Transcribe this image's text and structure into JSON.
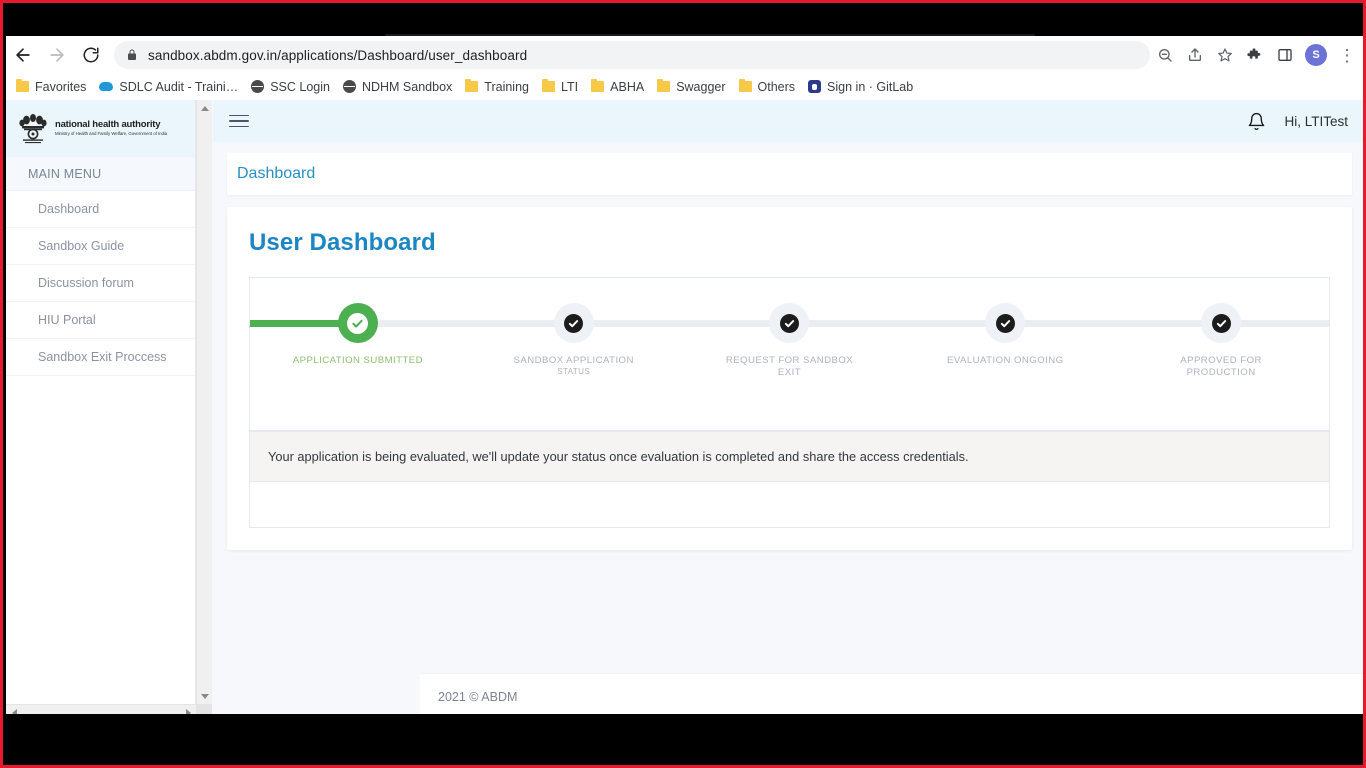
{
  "browser": {
    "back_label": "Back",
    "forward_label": "Forward",
    "reload_label": "Reload",
    "url": "sandbox.abdm.gov.in/applications/Dashboard/user_dashboard",
    "lock_icon": "lock-icon",
    "zoom_icon": "zoom-out-icon",
    "share_icon": "share-icon",
    "bookmark_icon": "star-icon",
    "extensions_icon": "puzzle-piece-icon",
    "sidepanel_icon": "side-panel-icon",
    "avatar_initial": "S",
    "menu_icon": "kebab-menu-icon",
    "bookmarks": [
      {
        "label": "Favorites",
        "icon": "folder-icon"
      },
      {
        "label": "SDLC Audit - Traini…",
        "icon": "cloud-icon"
      },
      {
        "label": "SSC Login",
        "icon": "globe-icon"
      },
      {
        "label": "NDHM Sandbox",
        "icon": "globe-icon"
      },
      {
        "label": "Training",
        "icon": "folder-icon"
      },
      {
        "label": "LTI",
        "icon": "folder-icon"
      },
      {
        "label": "ABHA",
        "icon": "folder-icon"
      },
      {
        "label": "Swagger",
        "icon": "folder-icon"
      },
      {
        "label": "Others",
        "icon": "folder-icon"
      },
      {
        "label": "Sign in · GitLab",
        "icon": "gitlab-icon"
      }
    ]
  },
  "sidebar": {
    "logo": {
      "line1": "national health authority",
      "line2": "Ministry of Health and Family Welfare, Government of India"
    },
    "section_title": "MAIN MENU",
    "items": [
      {
        "label": "Dashboard"
      },
      {
        "label": "Sandbox Guide"
      },
      {
        "label": "Discussion forum"
      },
      {
        "label": "HIU Portal"
      },
      {
        "label": "Sandbox Exit Proccess"
      }
    ]
  },
  "topbar": {
    "menu_toggle_icon": "hamburger-icon",
    "notification_icon": "bell-icon",
    "greeting": "Hi, LTITest"
  },
  "breadcrumb": {
    "title": "Dashboard"
  },
  "panel": {
    "title": "User Dashboard",
    "status_message": "Your application is being evaluated, we'll update your status once evaluation is completed and share the access credentials."
  },
  "stepper": {
    "steps": [
      {
        "label": "APPLICATION SUBMITTED",
        "sub": "",
        "state": "done"
      },
      {
        "label": "SANDBOX APPLICATION",
        "sub": "STATUS",
        "state": "pending"
      },
      {
        "label": "REQUEST FOR SANDBOX EXIT",
        "sub": "",
        "state": "pending"
      },
      {
        "label": "EVALUATION ONGOING",
        "sub": "",
        "state": "pending"
      },
      {
        "label": "APPROVED FOR PRODUCTION",
        "sub": "",
        "state": "pending"
      }
    ]
  },
  "footer": {
    "copyright": "2021 © ABDM"
  },
  "colors": {
    "accent_blue": "#1c86c4",
    "brand_header": "#eaf6fc",
    "step_done_green": "#4caf50",
    "step_label_green": "#8fbf6f",
    "page_bg": "#f6f8fc",
    "border_red": "#e8192c"
  }
}
